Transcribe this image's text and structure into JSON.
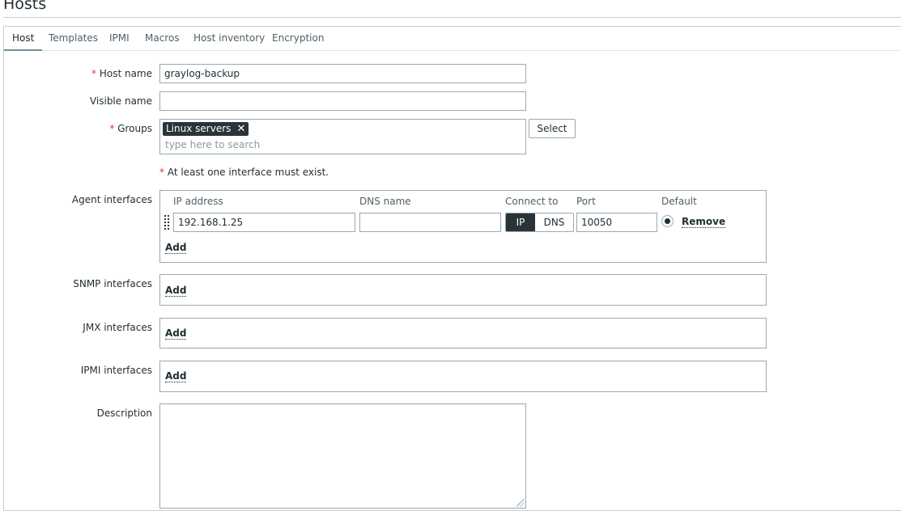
{
  "page": {
    "title": "Hosts"
  },
  "tabs": [
    "Host",
    "Templates",
    "IPMI",
    "Macros",
    "Host inventory",
    "Encryption"
  ],
  "form": {
    "host_name": {
      "label": "Host name",
      "value": "graylog-backup"
    },
    "visible_name": {
      "label": "Visible name",
      "value": ""
    },
    "groups": {
      "label": "Groups",
      "chip": "Linux servers",
      "placeholder": "type here to search",
      "select_button": "Select"
    },
    "notice": "At least one interface must exist.",
    "required_mark": "*",
    "agent_interfaces": {
      "label": "Agent interfaces",
      "headers": {
        "ip": "IP address",
        "dns": "DNS name",
        "connect": "Connect to",
        "port": "Port",
        "default": "Default"
      },
      "row": {
        "ip": "192.168.1.25",
        "dns": "",
        "connect_ip": "IP",
        "connect_dns": "DNS",
        "port": "10050",
        "remove": "Remove"
      },
      "add": "Add"
    },
    "snmp_interfaces": {
      "label": "SNMP interfaces",
      "add": "Add"
    },
    "jmx_interfaces": {
      "label": "JMX interfaces",
      "add": "Add"
    },
    "ipmi_interfaces": {
      "label": "IPMI interfaces",
      "add": "Add"
    },
    "description": {
      "label": "Description",
      "value": ""
    }
  },
  "colors": {
    "required": "#e33734",
    "dark": "#2a3338",
    "border": "#9aa9b1"
  }
}
